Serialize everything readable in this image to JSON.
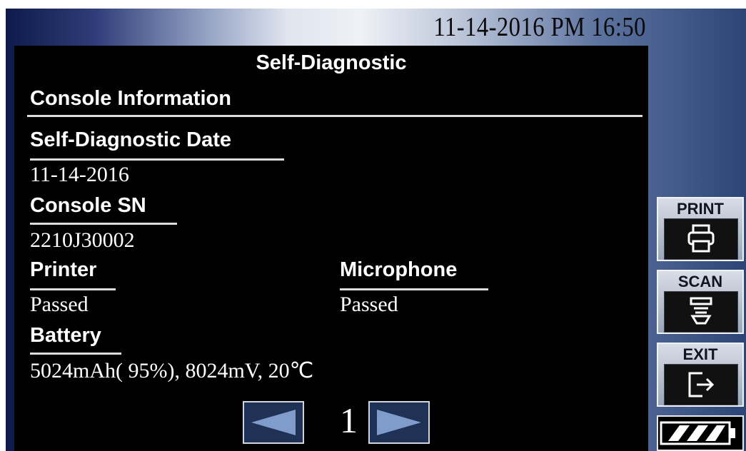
{
  "datetime": "11-14-2016 PM 16:50",
  "title": "Self-Diagnostic",
  "section": "Console Information",
  "fields": {
    "date_label": "Self-Diagnostic Date",
    "date_value": "11-14-2016",
    "sn_label": "Console SN",
    "sn_value": "2210J30002",
    "printer_label": "Printer",
    "printer_value": "Passed",
    "microphone_label": "Microphone",
    "microphone_value": "Passed",
    "battery_label": "Battery",
    "battery_value": "5024mAh( 95%), 8024mV, 20℃"
  },
  "pagination": {
    "page": "1"
  },
  "sidebar": {
    "print_label": "PRINT",
    "scan_label": "SCAN",
    "exit_label": "EXIT"
  },
  "icons": {
    "print": "printer-icon",
    "scan": "scanner-icon",
    "exit": "exit-icon",
    "prev": "left-arrow-icon",
    "next": "right-arrow-icon",
    "battery": "battery-icon"
  },
  "colors": {
    "panel_bg": "#000000",
    "nav_button_bg": "#1f3154",
    "arrow": "#7f9ccb"
  }
}
